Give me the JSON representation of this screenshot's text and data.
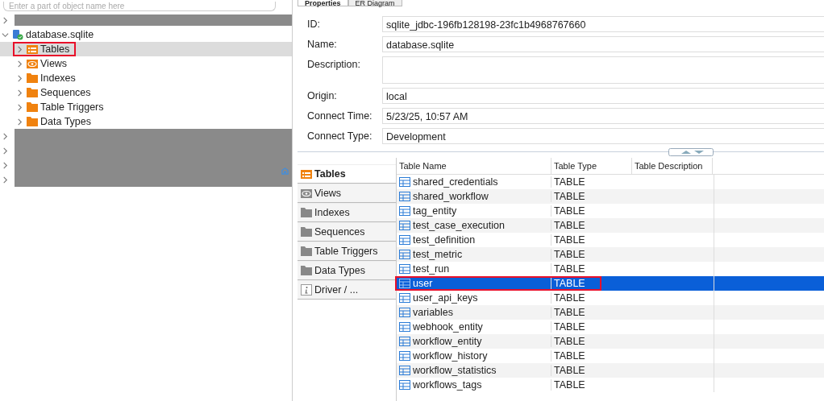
{
  "search": {
    "placeholder": "Enter a part of object name here"
  },
  "tree": [
    {
      "kind": "redacted",
      "expanded": false
    },
    {
      "kind": "database",
      "label": "database.sqlite",
      "expanded": true,
      "children": [
        {
          "kind": "tables",
          "label": "Tables",
          "selected": true,
          "annotated": true
        },
        {
          "kind": "views",
          "label": "Views",
          "selected": false,
          "annotated": false
        },
        {
          "kind": "folder",
          "label": "Indexes",
          "selected": false,
          "annotated": false
        },
        {
          "kind": "folder",
          "label": "Sequences",
          "selected": false,
          "annotated": false
        },
        {
          "kind": "folder",
          "label": "Table Triggers",
          "selected": false,
          "annotated": false
        },
        {
          "kind": "folder",
          "label": "Data Types",
          "selected": false,
          "annotated": false
        }
      ]
    },
    {
      "kind": "redacted",
      "expanded": false
    },
    {
      "kind": "redacted",
      "expanded": false
    },
    {
      "kind": "redacted",
      "expanded": false
    },
    {
      "kind": "redacted",
      "expanded": false
    }
  ],
  "editor_tabs": [
    {
      "label": "Properties",
      "selected": true
    },
    {
      "label": "ER Diagram",
      "selected": false
    }
  ],
  "properties": [
    {
      "kind": "line",
      "label": "ID:",
      "value": "sqlite_jdbc-196fb128198-23fc1b4968767660"
    },
    {
      "kind": "line",
      "label": "Name:",
      "value": "database.sqlite"
    },
    {
      "kind": "area",
      "label": "Description:"
    },
    {
      "kind": "line",
      "label": "Origin:",
      "value": "local"
    },
    {
      "kind": "line",
      "label": "Connect Time:",
      "value": "5/23/25, 10:57 AM"
    },
    {
      "kind": "line",
      "label": "Connect Type:",
      "value": "Development"
    }
  ],
  "side_tabs": [
    {
      "kind": "tables",
      "label": "Tables",
      "selected": true
    },
    {
      "kind": "views",
      "label": "Views",
      "selected": false
    },
    {
      "kind": "folder",
      "label": "Indexes",
      "selected": false
    },
    {
      "kind": "folder",
      "label": "Sequences",
      "selected": false
    },
    {
      "kind": "folder",
      "label": "Table Triggers",
      "selected": false
    },
    {
      "kind": "folder",
      "label": "Data Types",
      "selected": false
    },
    {
      "kind": "info",
      "label": "Driver / ...",
      "selected": false
    }
  ],
  "table": {
    "columns": [
      "Table Name",
      "Table Type",
      "Table Description"
    ],
    "rows": [
      {
        "name": "shared_credentials",
        "type": "TABLE",
        "selected": false,
        "annotated": false
      },
      {
        "name": "shared_workflow",
        "type": "TABLE",
        "selected": false,
        "annotated": false
      },
      {
        "name": "tag_entity",
        "type": "TABLE",
        "selected": false,
        "annotated": false
      },
      {
        "name": "test_case_execution",
        "type": "TABLE",
        "selected": false,
        "annotated": false
      },
      {
        "name": "test_definition",
        "type": "TABLE",
        "selected": false,
        "annotated": false
      },
      {
        "name": "test_metric",
        "type": "TABLE",
        "selected": false,
        "annotated": false
      },
      {
        "name": "test_run",
        "type": "TABLE",
        "selected": false,
        "annotated": false
      },
      {
        "name": "user",
        "type": "TABLE",
        "selected": true,
        "annotated": true
      },
      {
        "name": "user_api_keys",
        "type": "TABLE",
        "selected": false,
        "annotated": false
      },
      {
        "name": "variables",
        "type": "TABLE",
        "selected": false,
        "annotated": false
      },
      {
        "name": "webhook_entity",
        "type": "TABLE",
        "selected": false,
        "annotated": false
      },
      {
        "name": "workflow_entity",
        "type": "TABLE",
        "selected": false,
        "annotated": false
      },
      {
        "name": "workflow_history",
        "type": "TABLE",
        "selected": false,
        "annotated": false
      },
      {
        "name": "workflow_statistics",
        "type": "TABLE",
        "selected": false,
        "annotated": false
      },
      {
        "name": "workflows_tags",
        "type": "TABLE",
        "selected": false,
        "annotated": false
      }
    ]
  }
}
